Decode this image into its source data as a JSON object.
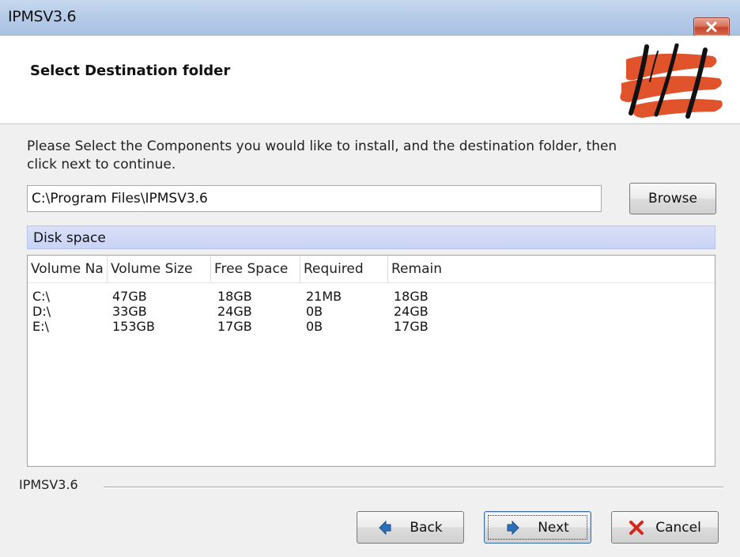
{
  "window": {
    "title": "IPMSV3.6"
  },
  "header": {
    "title": "Select Destination folder"
  },
  "instructions": "Please Select the Components you would like to install, and the destination folder, then click next to continue.",
  "path_field": {
    "value": "C:\\Program Files\\IPMSV3.6"
  },
  "browse_label": "Browse",
  "disk": {
    "header": "Disk space",
    "columns": [
      "Volume Na",
      "Volume Size",
      "Free Space",
      "Required",
      "Remain"
    ],
    "rows": [
      [
        "C:\\",
        "47GB",
        "18GB",
        "21MB",
        "18GB"
      ],
      [
        "D:\\",
        "33GB",
        "24GB",
        "0B",
        "24GB"
      ],
      [
        "E:\\",
        "153GB",
        "17GB",
        "0B",
        "17GB"
      ]
    ]
  },
  "footer": {
    "label": "IPMSV3.6"
  },
  "buttons": {
    "back": "Back",
    "next": "Next",
    "cancel": "Cancel"
  },
  "icons": {
    "close": "close-icon",
    "logo": "brand-logo",
    "back": "arrow-left-icon",
    "next": "arrow-right-icon",
    "cancel": "cancel-x-icon"
  },
  "colors": {
    "titlebar": "#b7cce8",
    "close_button": "#c7452d",
    "logo_red": "#e1532b",
    "disk_header": "#c9d3f5",
    "arrow_blue": "#2d6fb8",
    "cancel_red": "#d5281c"
  }
}
